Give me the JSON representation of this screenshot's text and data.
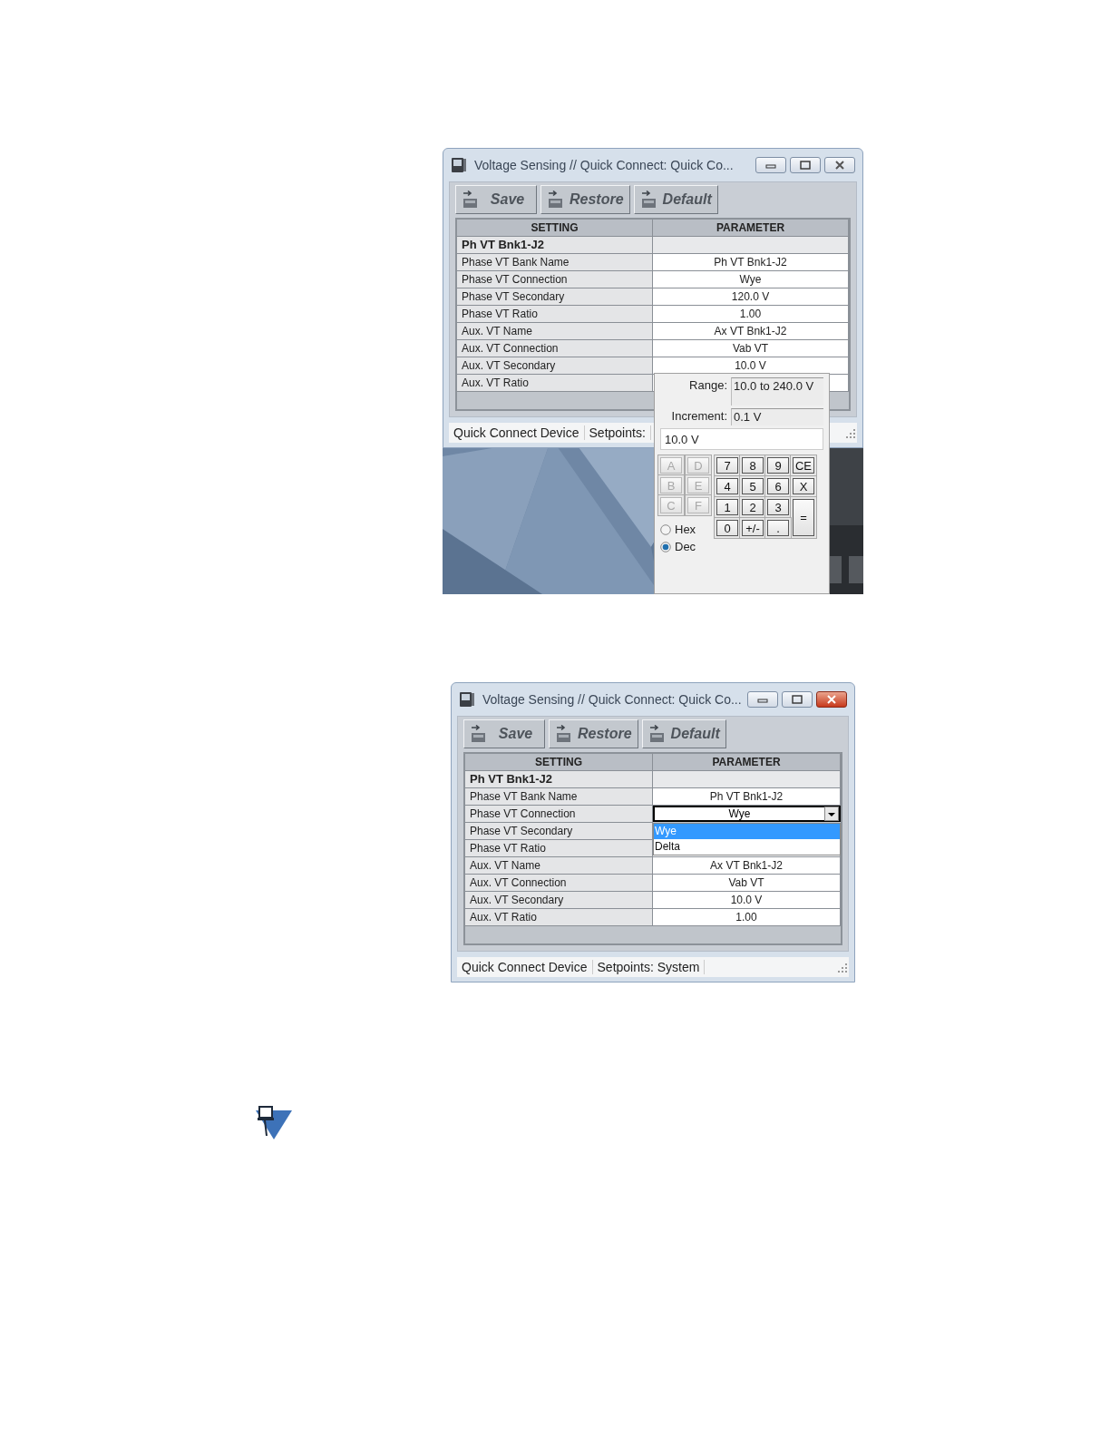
{
  "screenshots": [
    {
      "window": {
        "title": "Voltage Sensing // Quick Connect: Quick Co...",
        "active": false
      },
      "toolbar": [
        {
          "label": "Save"
        },
        {
          "label": "Restore"
        },
        {
          "label": "Default"
        }
      ],
      "columns": [
        "SETTING",
        "PARAMETER"
      ],
      "group": "Ph VT Bnk1-J2",
      "rows": [
        {
          "setting": "Phase VT Bank Name",
          "parameter": "Ph VT Bnk1-J2",
          "kind": "value"
        },
        {
          "setting": "Phase VT Connection",
          "parameter": "Wye",
          "kind": "value"
        },
        {
          "setting": "Phase VT Secondary",
          "parameter": "120.0 V",
          "kind": "value"
        },
        {
          "setting": "Phase VT Ratio",
          "parameter": "1.00",
          "kind": "value"
        },
        {
          "setting": "Aux. VT Name",
          "parameter": "Ax VT Bnk1-J2",
          "kind": "value"
        },
        {
          "setting": "Aux. VT Connection",
          "parameter": "Vab VT",
          "kind": "value"
        },
        {
          "setting": "Aux. VT Secondary",
          "parameter": "10.0 V",
          "kind": "value"
        },
        {
          "setting": "Aux. VT Ratio",
          "kind": "value"
        }
      ],
      "status_bar": [
        "Quick Connect Device",
        "Setpoints:"
      ],
      "desktop": {
        "kind": "picture"
      },
      "keypad": {
        "range_label": "Range:",
        "range": "10.0 to 240.0 V",
        "increment_label": "Increment:",
        "increment": "0.1 V",
        "entry": "10.0 V",
        "hex_keys": [
          {
            "label": "A",
            "disabled": true
          },
          {
            "label": "D",
            "disabled": true
          },
          {
            "label": "B",
            "disabled": true
          },
          {
            "label": "E",
            "disabled": true
          },
          {
            "label": "C",
            "disabled": true
          },
          {
            "label": "F",
            "disabled": true
          }
        ],
        "keys": [
          {
            "label": "7",
            "kind": "normal"
          },
          {
            "label": "8",
            "kind": "normal"
          },
          {
            "label": "9",
            "kind": "normal"
          },
          {
            "label": "CE",
            "kind": "normal"
          },
          {
            "label": "4",
            "kind": "normal"
          },
          {
            "label": "5",
            "kind": "normal"
          },
          {
            "label": "6",
            "kind": "normal"
          },
          {
            "label": "X",
            "kind": "normal"
          },
          {
            "label": "1",
            "kind": "normal"
          },
          {
            "label": "2",
            "kind": "normal"
          },
          {
            "label": "3",
            "kind": "normal"
          },
          {
            "label": "=",
            "kind": "tall"
          },
          {
            "label": "0",
            "kind": "normal"
          },
          {
            "label": "+/-",
            "kind": "normal"
          },
          {
            "label": ".",
            "kind": "normal"
          }
        ],
        "modes": [
          {
            "label": "Hex",
            "selected": false
          },
          {
            "label": "Dec",
            "selected": true
          }
        ]
      }
    },
    {
      "window": {
        "title": "Voltage Sensing // Quick Connect: Quick Co...",
        "active": true
      },
      "toolbar": [
        {
          "label": "Save"
        },
        {
          "label": "Restore"
        },
        {
          "label": "Default"
        }
      ],
      "columns": [
        "SETTING",
        "PARAMETER"
      ],
      "group": "Ph VT Bnk1-J2",
      "rows": [
        {
          "setting": "Phase VT Bank Name",
          "parameter": "Ph VT Bnk1-J2",
          "kind": "value"
        },
        {
          "setting": "Phase VT Connection",
          "parameter": "Wye",
          "kind": "dropdown",
          "expanded": true,
          "options": [
            {
              "label": "Wye",
              "selected": true
            },
            {
              "label": "Delta",
              "selected": false
            }
          ]
        },
        {
          "setting": "Phase VT Secondary",
          "kind": "value"
        },
        {
          "setting": "Phase VT Ratio",
          "kind": "value"
        },
        {
          "setting": "Aux. VT Name",
          "parameter": "Ax VT Bnk1-J2",
          "kind": "value"
        },
        {
          "setting": "Aux. VT Connection",
          "parameter": "Vab VT",
          "kind": "value"
        },
        {
          "setting": "Aux. VT Secondary",
          "parameter": "10.0 V",
          "kind": "value"
        },
        {
          "setting": "Aux. VT Ratio",
          "parameter": "1.00",
          "kind": "value"
        }
      ],
      "status_bar": [
        "Quick Connect Device",
        "Setpoints: System"
      ]
    }
  ]
}
